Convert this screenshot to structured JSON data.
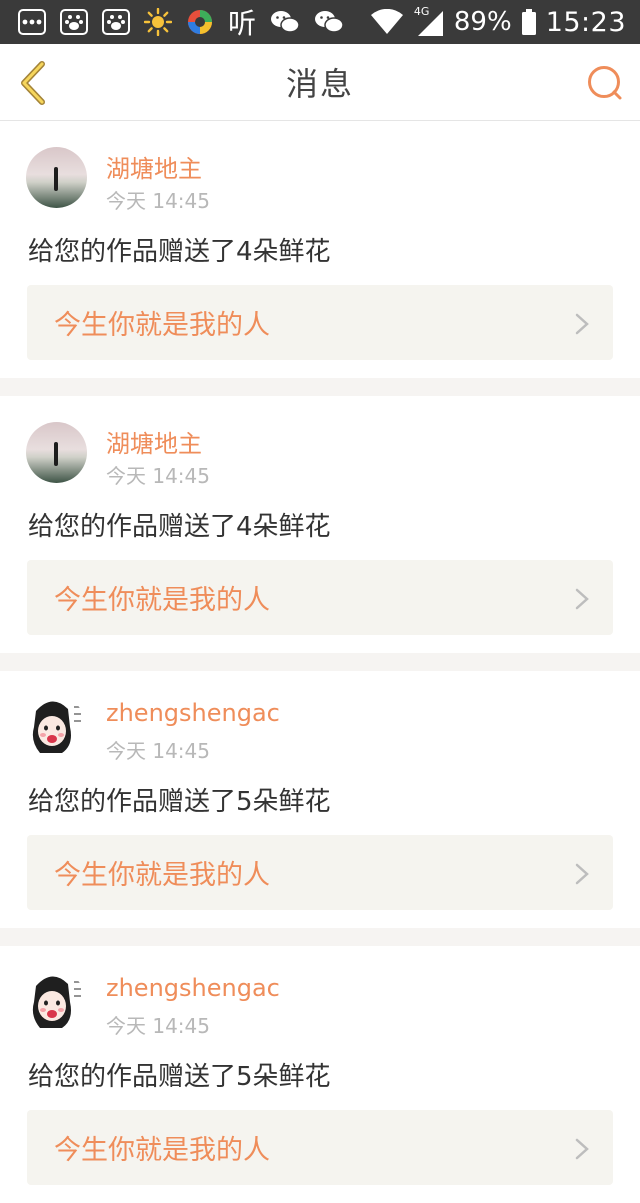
{
  "status_bar": {
    "network": "4G",
    "battery": "89%",
    "time": "15:23",
    "icons": [
      "more-icon",
      "baidu-paw-icon",
      "baidu-paw-icon",
      "sun-icon",
      "app-ring-icon",
      "ting-icon",
      "wechat-icon",
      "wechat-icon",
      "wifi-icon",
      "signal-icon",
      "battery-icon"
    ],
    "ting_label": "听"
  },
  "header": {
    "title": "消息",
    "back_icon": "chevron-left-icon",
    "search_icon": "search-icon",
    "accent": "#ef8d5a"
  },
  "messages": [
    {
      "username": "湖塘地主",
      "time": "今天 14:45",
      "text": "给您的作品赠送了4朵鲜花",
      "work_title": "今生你就是我的人",
      "avatar": "lake-scene"
    },
    {
      "username": "湖塘地主",
      "time": "今天 14:45",
      "text": "给您的作品赠送了4朵鲜花",
      "work_title": "今生你就是我的人",
      "avatar": "lake-scene"
    },
    {
      "username": "zhengshengac",
      "time": "今天 14:45",
      "text": "给您的作品赠送了5朵鲜花",
      "work_title": "今生你就是我的人",
      "avatar": "cartoon-sketch"
    },
    {
      "username": "zhengshengac",
      "time": "今天 14:45",
      "text": "给您的作品赠送了5朵鲜花",
      "work_title": "今生你就是我的人",
      "avatar": "cartoon-sketch"
    }
  ]
}
